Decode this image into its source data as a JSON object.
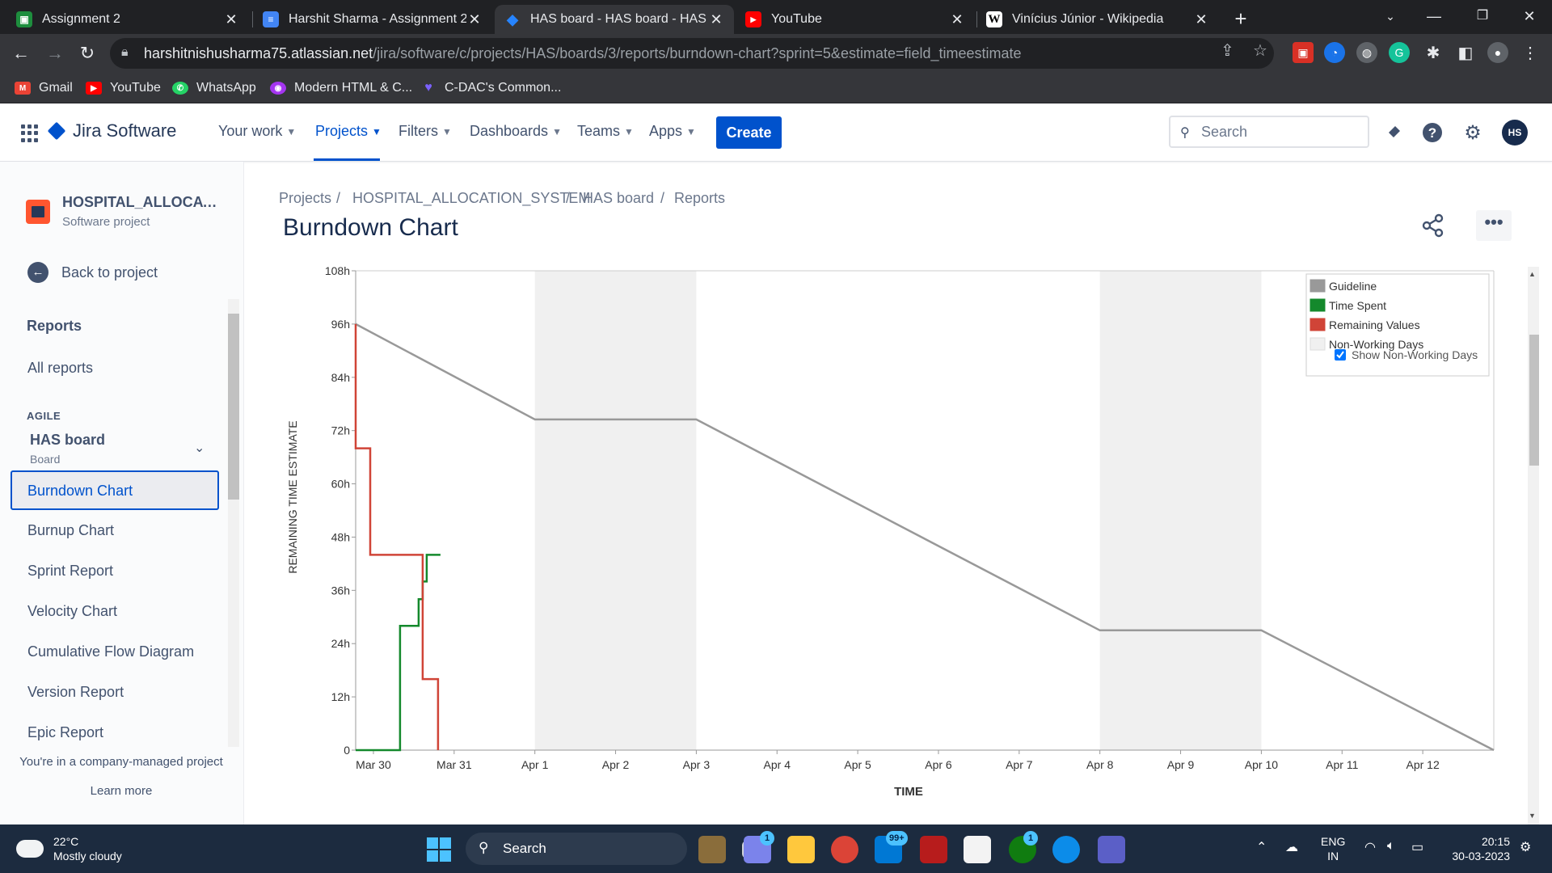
{
  "browser": {
    "tabs": [
      {
        "title": "Assignment 2",
        "icon": "classroom-icon",
        "color": "#1e8e3e"
      },
      {
        "title": "Harshit Sharma - Assignment 2 -",
        "icon": "docs-icon",
        "color": "#4285f4"
      },
      {
        "title": "HAS board - HAS board - HAS bo",
        "icon": "jira-icon",
        "color": "#2684ff"
      },
      {
        "title": "YouTube",
        "icon": "youtube-icon",
        "color": "#ff0000"
      },
      {
        "title": "Vinícius Júnior - Wikipedia",
        "icon": "wikipedia-icon",
        "color": "#ffffff"
      }
    ],
    "url_host": "harshitnishusharma75.atlassian.net",
    "url_path": "/jira/software/c/projects/HAS/boards/3/reports/burndown-chart?sprint=5&estimate=field_timeestimate",
    "bookmarks": [
      {
        "label": "Gmail",
        "icon": "gmail-icon",
        "color": "#ea4335"
      },
      {
        "label": "YouTube",
        "icon": "youtube-icon",
        "color": "#ff0000"
      },
      {
        "label": "WhatsApp",
        "icon": "whatsapp-icon",
        "color": "#25d366"
      },
      {
        "label": "Modern HTML & C...",
        "icon": "course-icon",
        "color": "#a435f0"
      },
      {
        "label": "C-DAC's Common...",
        "icon": "heart-icon",
        "color": "#7b61ff"
      }
    ]
  },
  "jira": {
    "product": "Jira Software",
    "nav": [
      {
        "label": "Your work"
      },
      {
        "label": "Projects"
      },
      {
        "label": "Filters"
      },
      {
        "label": "Dashboards"
      },
      {
        "label": "Teams"
      },
      {
        "label": "Apps"
      }
    ],
    "create_label": "Create",
    "search_placeholder": "Search",
    "avatar_initials": "HS",
    "accent": "#0052cc"
  },
  "sidebar": {
    "project_name": "HOSPITAL_ALLOCATIO...",
    "project_type": "Software project",
    "back_label": "Back to project",
    "reports_heading": "Reports",
    "all_reports": "All reports",
    "agile_heading": "AGILE",
    "board_name": "HAS board",
    "board_sub": "Board",
    "selected_item": "Burndown Chart",
    "items": [
      {
        "label": "Burnup Chart"
      },
      {
        "label": "Sprint Report"
      },
      {
        "label": "Velocity Chart"
      },
      {
        "label": "Cumulative Flow Diagram"
      },
      {
        "label": "Version Report"
      },
      {
        "label": "Epic Report"
      }
    ],
    "footer": "You're in a company-managed project",
    "learn_more": "Learn more"
  },
  "main": {
    "breadcrumbs": [
      {
        "label": "Projects"
      },
      {
        "label": "HOSPITAL_ALLOCATION_SYSTEM"
      },
      {
        "label": "HAS board"
      },
      {
        "label": "Reports"
      }
    ],
    "title": "Burndown Chart"
  },
  "chart_data": {
    "type": "line",
    "ylabel": "REMAINING TIME ESTIMATE",
    "xlabel": "TIME",
    "y_ticks": [
      "0",
      "12h",
      "24h",
      "36h",
      "48h",
      "60h",
      "72h",
      "84h",
      "96h",
      "108h"
    ],
    "ylim": [
      0,
      108
    ],
    "xlim": [
      0,
      14.1
    ],
    "x_ticks": [
      {
        "label": "Mar 30",
        "x": 0.22
      },
      {
        "label": "Mar 31",
        "x": 1.22
      },
      {
        "label": "Apr 1",
        "x": 2.22
      },
      {
        "label": "Apr 2",
        "x": 3.22
      },
      {
        "label": "Apr 3",
        "x": 4.22
      },
      {
        "label": "Apr 4",
        "x": 5.22
      },
      {
        "label": "Apr 5",
        "x": 6.22
      },
      {
        "label": "Apr 6",
        "x": 7.22
      },
      {
        "label": "Apr 7",
        "x": 8.22
      },
      {
        "label": "Apr 8",
        "x": 9.22
      },
      {
        "label": "Apr 9",
        "x": 10.22
      },
      {
        "label": "Apr 10",
        "x": 11.22
      },
      {
        "label": "Apr 11",
        "x": 12.22
      },
      {
        "label": "Apr 12",
        "x": 13.22
      }
    ],
    "non_working_days": [
      [
        2.22,
        4.22
      ],
      [
        9.22,
        11.22
      ]
    ],
    "series": [
      {
        "name": "Guideline",
        "color": "#999999",
        "step": false,
        "points": [
          [
            0,
            96
          ],
          [
            2.22,
            74.5
          ],
          [
            4.22,
            74.5
          ],
          [
            9.22,
            27
          ],
          [
            11.22,
            27
          ],
          [
            14.1,
            0
          ]
        ]
      },
      {
        "name": "Time Spent",
        "color": "#14892c",
        "step": true,
        "points": [
          [
            0,
            0
          ],
          [
            0.55,
            0
          ],
          [
            0.55,
            28
          ],
          [
            0.78,
            28
          ],
          [
            0.78,
            34
          ],
          [
            0.83,
            34
          ],
          [
            0.83,
            38
          ],
          [
            0.88,
            38
          ],
          [
            0.88,
            44
          ],
          [
            1.05,
            44
          ]
        ]
      },
      {
        "name": "Remaining Values",
        "color": "#d04437",
        "step": true,
        "points": [
          [
            0,
            96
          ],
          [
            0,
            68
          ],
          [
            0.18,
            68
          ],
          [
            0.18,
            44
          ],
          [
            0.83,
            44
          ],
          [
            0.83,
            16
          ],
          [
            1.02,
            16
          ],
          [
            1.02,
            0
          ]
        ]
      }
    ],
    "legend": [
      {
        "label": "Guideline",
        "color": "#999999"
      },
      {
        "label": "Time Spent",
        "color": "#14892c"
      },
      {
        "label": "Remaining Values",
        "color": "#d04437"
      },
      {
        "label": "Non-Working Days",
        "color": "#f0f0f0"
      }
    ],
    "show_non_working_label": "Show Non-Working Days",
    "show_non_working_checked": true,
    "legend_position": "top-right",
    "grid": false
  },
  "taskbar": {
    "temperature": "22°C",
    "weather": "Mostly cloudy",
    "search": "Search",
    "badges": {
      "chat": "1",
      "mail": "99+",
      "xbox": "1"
    },
    "lang": "ENG",
    "region": "IN",
    "time": "20:15",
    "date": "30-03-2023"
  }
}
